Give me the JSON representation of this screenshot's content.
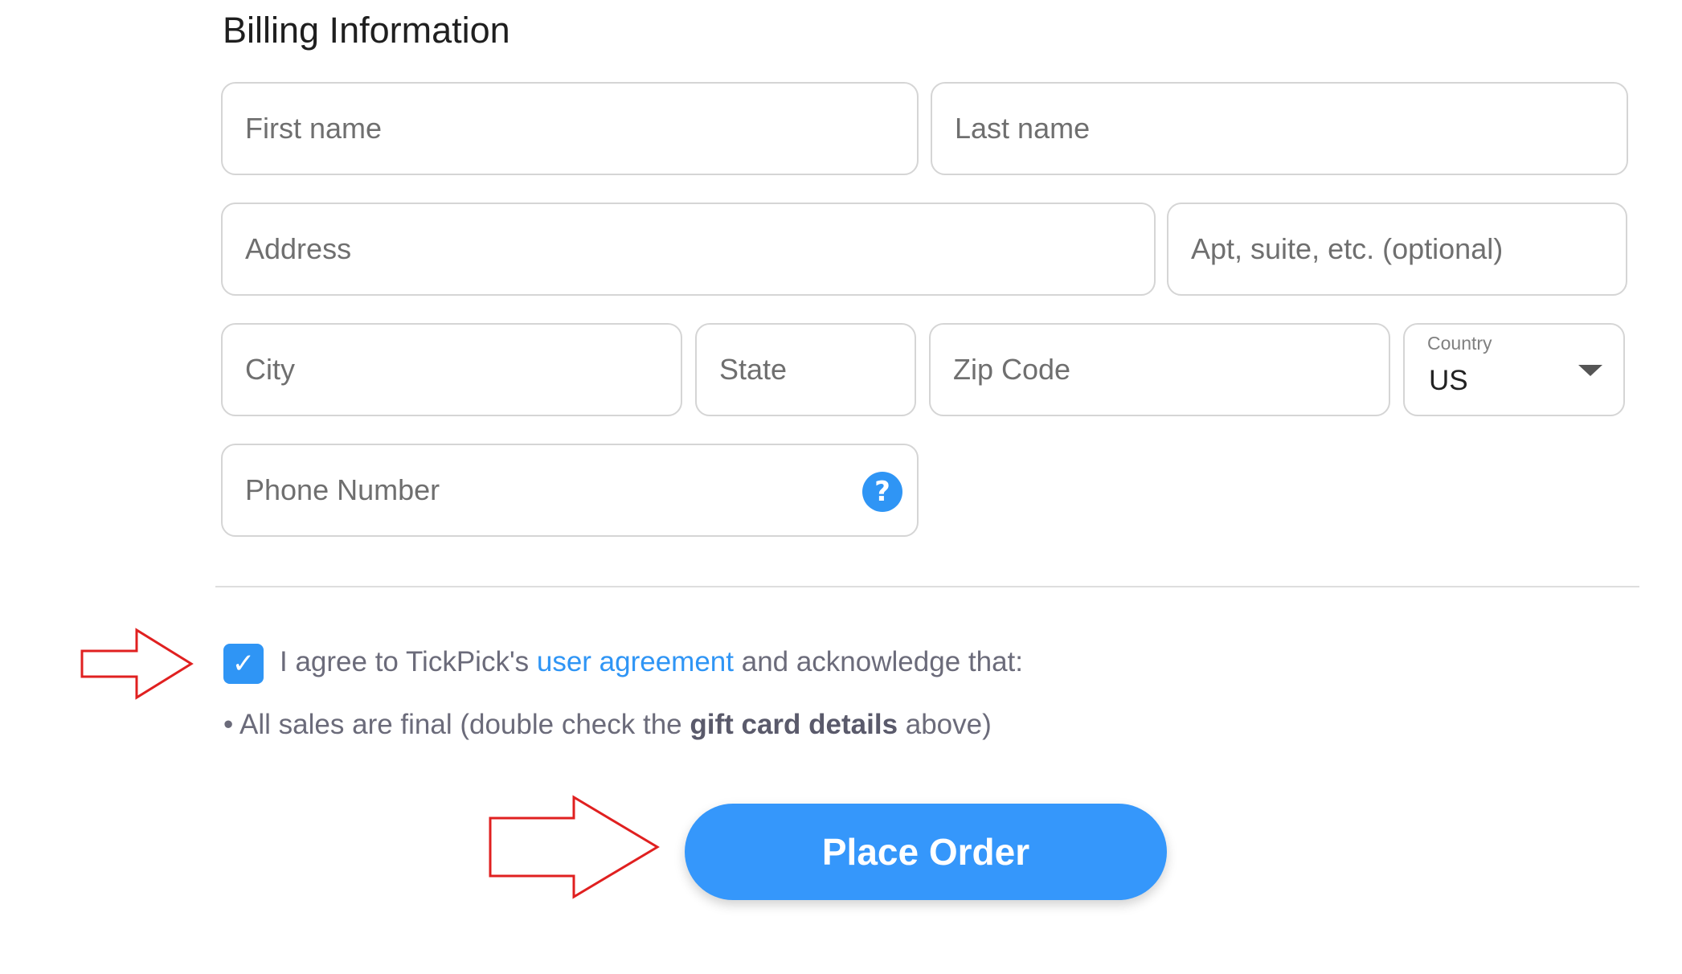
{
  "billing": {
    "title": "Billing Information",
    "fields": {
      "first_name": "First name",
      "last_name": "Last name",
      "address": "Address",
      "apt": "Apt, suite, etc. (optional)",
      "city": "City",
      "state": "State",
      "zip": "Zip Code",
      "phone": "Phone Number"
    },
    "country": {
      "label": "Country",
      "value": "US"
    },
    "help_icon": "?"
  },
  "agreement": {
    "checked": true,
    "checkmark": "✓",
    "prefix": "I agree to TickPick's ",
    "link": "user agreement",
    "suffix": " and acknowledge that:",
    "note_prefix": "• All sales are final (double check the ",
    "note_bold": "gift card details",
    "note_suffix": " above)"
  },
  "actions": {
    "place_order": "Place Order"
  },
  "colors": {
    "accent": "#3597fb",
    "annotation_arrow": "#e02020"
  }
}
